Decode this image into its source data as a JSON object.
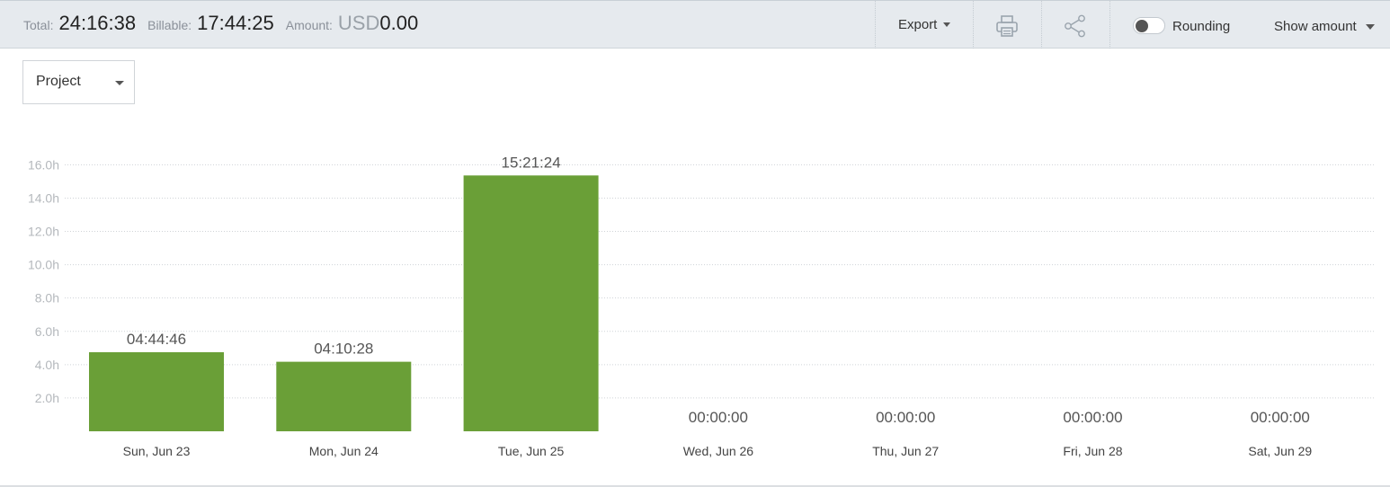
{
  "summary": {
    "total_label": "Total:",
    "total_value": "24:16:38",
    "billable_label": "Billable:",
    "billable_value": "17:44:25",
    "amount_label": "Amount:",
    "amount_currency": "USD",
    "amount_value": "0.00"
  },
  "toolbar": {
    "export_label": "Export",
    "print_icon": "printer-icon",
    "share_icon": "share-icon",
    "rounding_label": "Rounding",
    "rounding_on": false,
    "show_amount_label": "Show amount"
  },
  "group_by": {
    "selected": "Project"
  },
  "colors": {
    "bar": "#6a9f37",
    "topbar_bg": "#e6eaee"
  },
  "chart_data": {
    "type": "bar",
    "categories": [
      "Sun, Jun 23",
      "Mon, Jun 24",
      "Tue, Jun 25",
      "Wed, Jun 26",
      "Thu, Jun 27",
      "Fri, Jun 28",
      "Sat, Jun 29"
    ],
    "values": [
      4.746,
      4.174,
      15.357,
      0,
      0,
      0,
      0
    ],
    "data_labels": [
      "04:44:46",
      "04:10:28",
      "15:21:24",
      "00:00:00",
      "00:00:00",
      "00:00:00",
      "00:00:00"
    ],
    "y_ticks": [
      "2.0h",
      "4.0h",
      "6.0h",
      "8.0h",
      "10.0h",
      "12.0h",
      "14.0h",
      "16.0h"
    ],
    "ylim": [
      0,
      16
    ],
    "grid": true,
    "title": "",
    "xlabel": "",
    "ylabel": ""
  }
}
